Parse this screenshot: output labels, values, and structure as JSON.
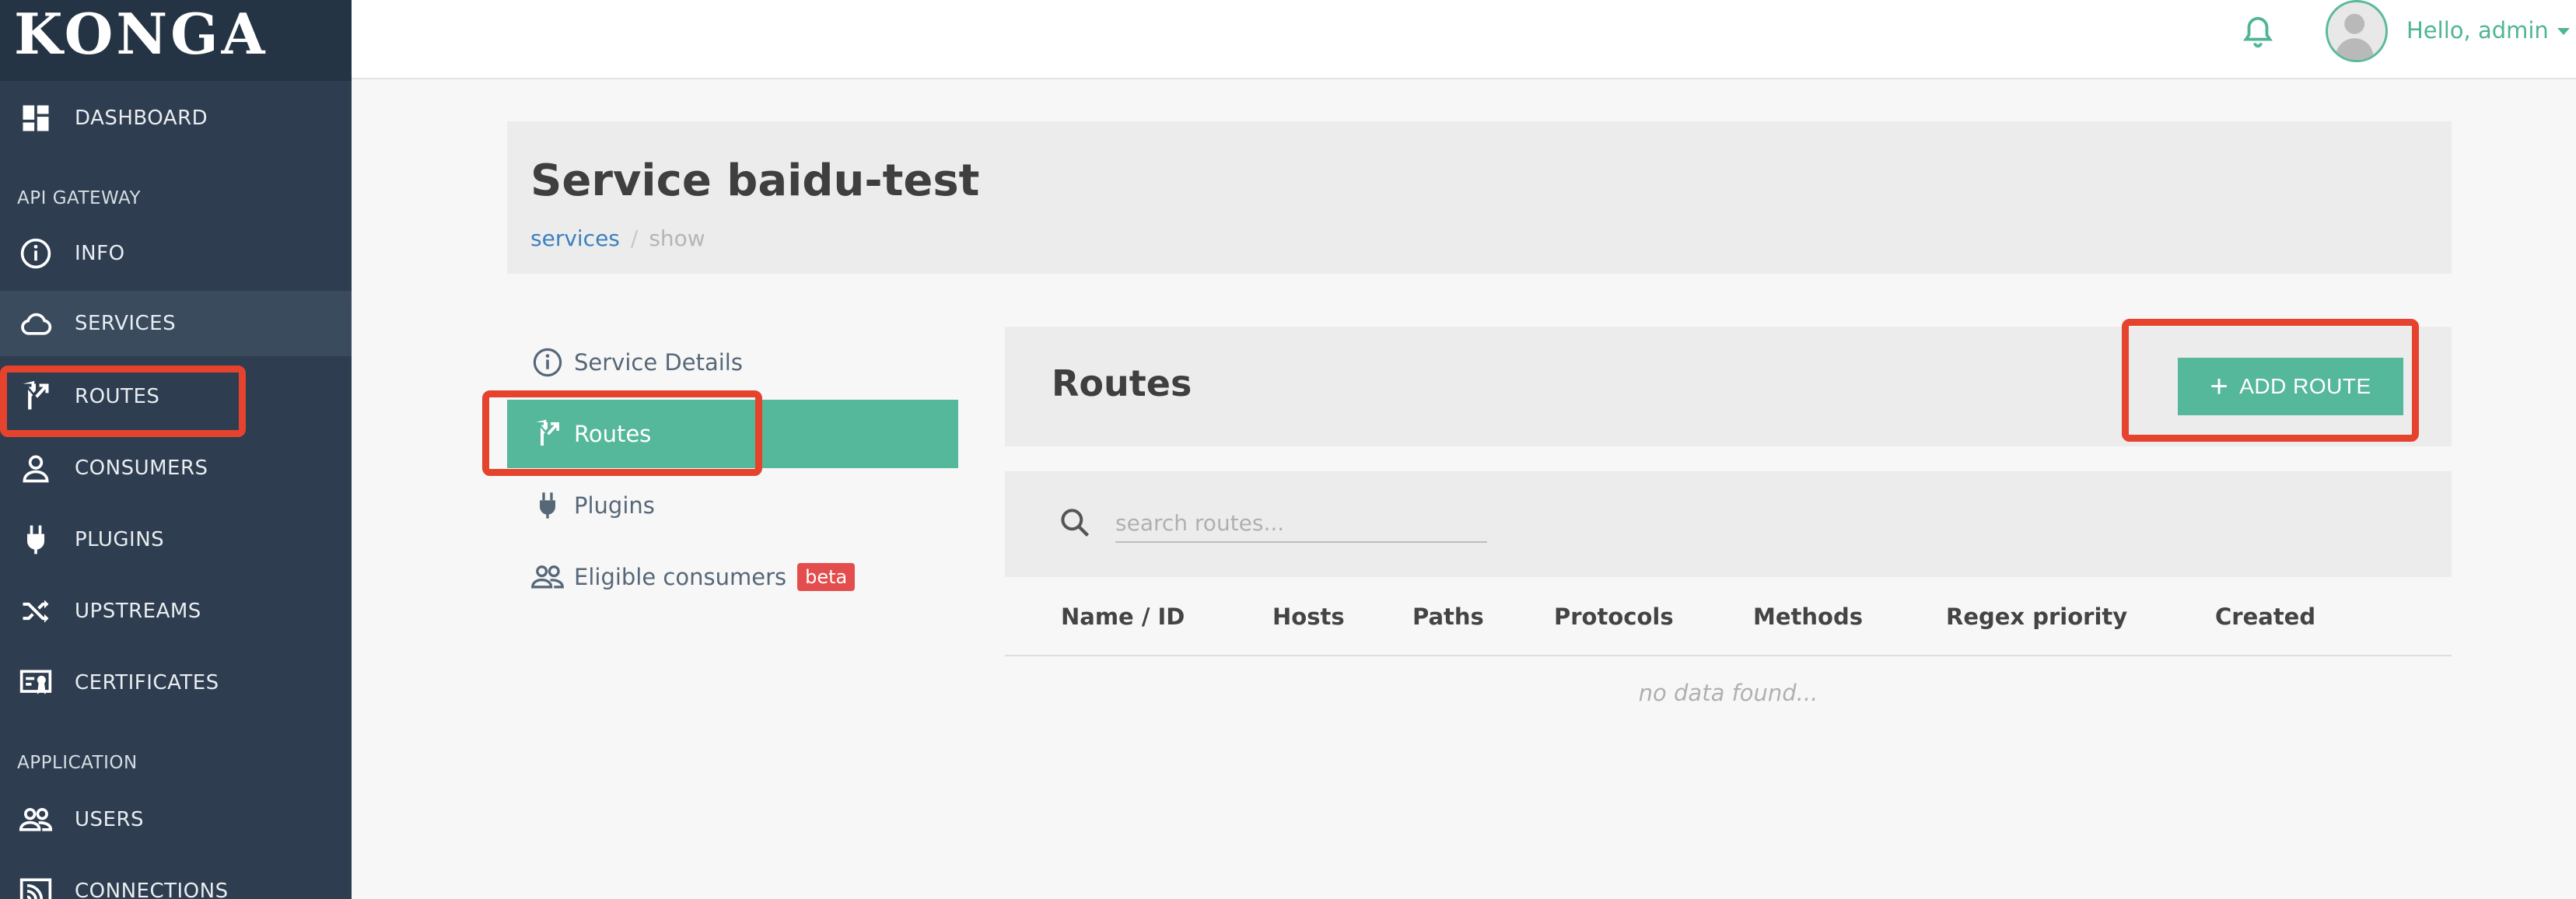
{
  "app": {
    "logo": "KONGA"
  },
  "sidebar": {
    "items": [
      {
        "label": "DASHBOARD",
        "icon": "dashboard-icon"
      },
      {
        "label": "INFO",
        "icon": "info-icon"
      },
      {
        "label": "SERVICES",
        "icon": "cloud-icon"
      },
      {
        "label": "ROUTES",
        "icon": "routes-icon"
      },
      {
        "label": "CONSUMERS",
        "icon": "user-icon"
      },
      {
        "label": "PLUGINS",
        "icon": "plug-icon"
      },
      {
        "label": "UPSTREAMS",
        "icon": "shuffle-icon"
      },
      {
        "label": "CERTIFICATES",
        "icon": "certificate-icon"
      },
      {
        "label": "USERS",
        "icon": "users-icon"
      },
      {
        "label": "CONNECTIONS",
        "icon": "connections-icon"
      }
    ],
    "sections": {
      "api_gateway": "API GATEWAY",
      "application": "APPLICATION"
    },
    "active_item": "SERVICES"
  },
  "topbar": {
    "greeting": "Hello, admin"
  },
  "page": {
    "title": "Service baidu-test",
    "breadcrumb": {
      "link": "services",
      "separator": "/",
      "current": "show"
    }
  },
  "subnav": {
    "items": [
      {
        "label": "Service Details",
        "icon": "info-icon"
      },
      {
        "label": "Routes",
        "icon": "routes-icon"
      },
      {
        "label": "Plugins",
        "icon": "plug-icon"
      },
      {
        "label": "Eligible consumers",
        "icon": "users-icon",
        "badge": "beta"
      }
    ],
    "active_item": "Routes"
  },
  "routes": {
    "title": "Routes",
    "add_button": "ADD ROUTE",
    "search_placeholder": "search routes...",
    "columns": [
      "Name / ID",
      "Hosts",
      "Paths",
      "Protocols",
      "Methods",
      "Regex priority",
      "Created"
    ],
    "empty_text": "no data found..."
  },
  "colors": {
    "sidebar_bg": "#2e3d4f",
    "accent": "#56b89a",
    "highlight": "#e5432d",
    "badge": "#e44d4d",
    "link": "#3d7fbf"
  }
}
